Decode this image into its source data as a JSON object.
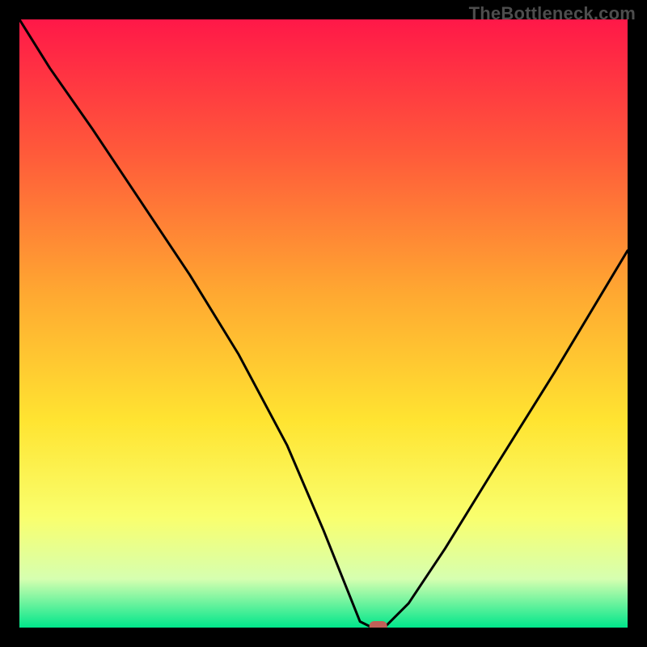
{
  "watermark": "TheBottleneck.com",
  "chart_data": {
    "type": "line",
    "title": "",
    "xlabel": "",
    "ylabel": "",
    "xlim": [
      0,
      100
    ],
    "ylim": [
      0,
      100
    ],
    "grid": false,
    "legend": false,
    "gradient_background": {
      "top_color": "#ff1848",
      "mid_colors": [
        "#ff5a3a",
        "#ffa831",
        "#ffe431",
        "#f9ff6e",
        "#d6ffb0"
      ],
      "bottom_color": "#00e68b"
    },
    "series": [
      {
        "name": "bottleneck-curve",
        "x": [
          0,
          5,
          12,
          20,
          28,
          36,
          44,
          50,
          54,
          56,
          58,
          60,
          64,
          70,
          78,
          88,
          100
        ],
        "y": [
          100,
          92,
          82,
          70,
          58,
          45,
          30,
          16,
          6,
          1,
          0,
          0,
          4,
          13,
          26,
          42,
          62
        ]
      }
    ],
    "marker": {
      "name": "current-point",
      "x": 59,
      "y": 0,
      "color": "#c06058"
    }
  }
}
